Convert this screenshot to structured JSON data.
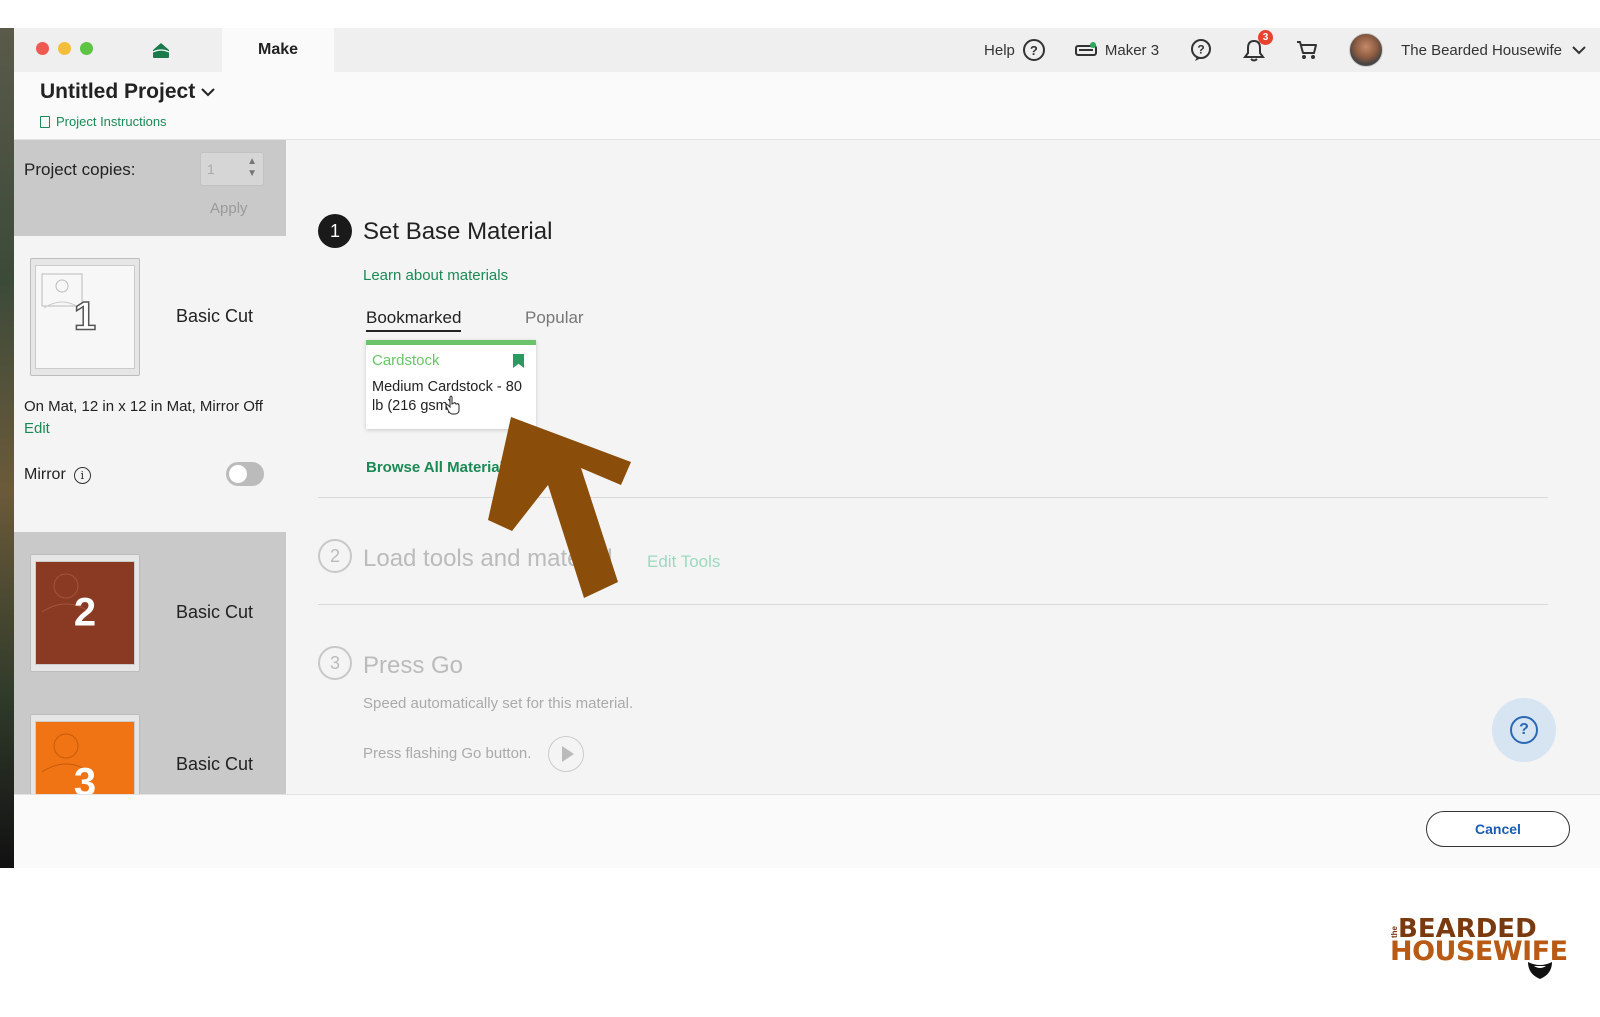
{
  "window": {
    "tab_make": "Make"
  },
  "toolbar": {
    "help_label": "Help",
    "machine_label": "Maker 3",
    "notification_count": "3",
    "user_name": "The Bearded Housewife"
  },
  "project": {
    "title": "Untitled Project",
    "instructions_link": "Project Instructions"
  },
  "sidebar": {
    "copies_label": "Project copies:",
    "copies_value": "1",
    "apply_label": "Apply",
    "mats": [
      {
        "number": "1",
        "label": "Basic Cut",
        "color": "#f7f7f7"
      },
      {
        "number": "2",
        "label": "Basic Cut",
        "color": "#8a3a22"
      },
      {
        "number": "3",
        "label": "Basic Cut",
        "color": "#f07414"
      }
    ],
    "mat_info": "On Mat, 12 in x 12 in Mat, Mirror Off",
    "edit_label": "Edit",
    "mirror_label": "Mirror",
    "mirror_on": false
  },
  "steps": {
    "step1": {
      "number": "1",
      "title": "Set Base Material",
      "learn_link": "Learn about materials",
      "tabs": [
        "Bookmarked",
        "Popular"
      ],
      "active_tab": "Bookmarked",
      "card": {
        "category": "Cardstock",
        "name": "Medium Cardstock - 80 lb (216 gsm)"
      },
      "browse_link": "Browse All Materials"
    },
    "step2": {
      "number": "2",
      "title": "Load tools and material",
      "edit_tools": "Edit Tools"
    },
    "step3": {
      "number": "3",
      "title": "Press Go",
      "desc1": "Speed automatically set for this material.",
      "desc2": "Press flashing Go button."
    }
  },
  "footer": {
    "cancel_label": "Cancel"
  },
  "logo": {
    "small": "the",
    "line1": "BEARDED",
    "line2": "HOUSEWIFE"
  },
  "colors": {
    "accent_green": "#1a8a55",
    "card_green": "#6ac46a",
    "arrow_brown": "#8b4d0a",
    "cancel_blue": "#1a5bb8"
  },
  "icons": {
    "home": "home-icon",
    "help": "question-circle-icon",
    "machine": "cricut-machine-icon",
    "bell": "bell-icon",
    "cart": "cart-icon",
    "chevron": "chevron-down-icon",
    "bookmark": "bookmark-icon",
    "info": "info-icon",
    "play": "play-icon"
  }
}
